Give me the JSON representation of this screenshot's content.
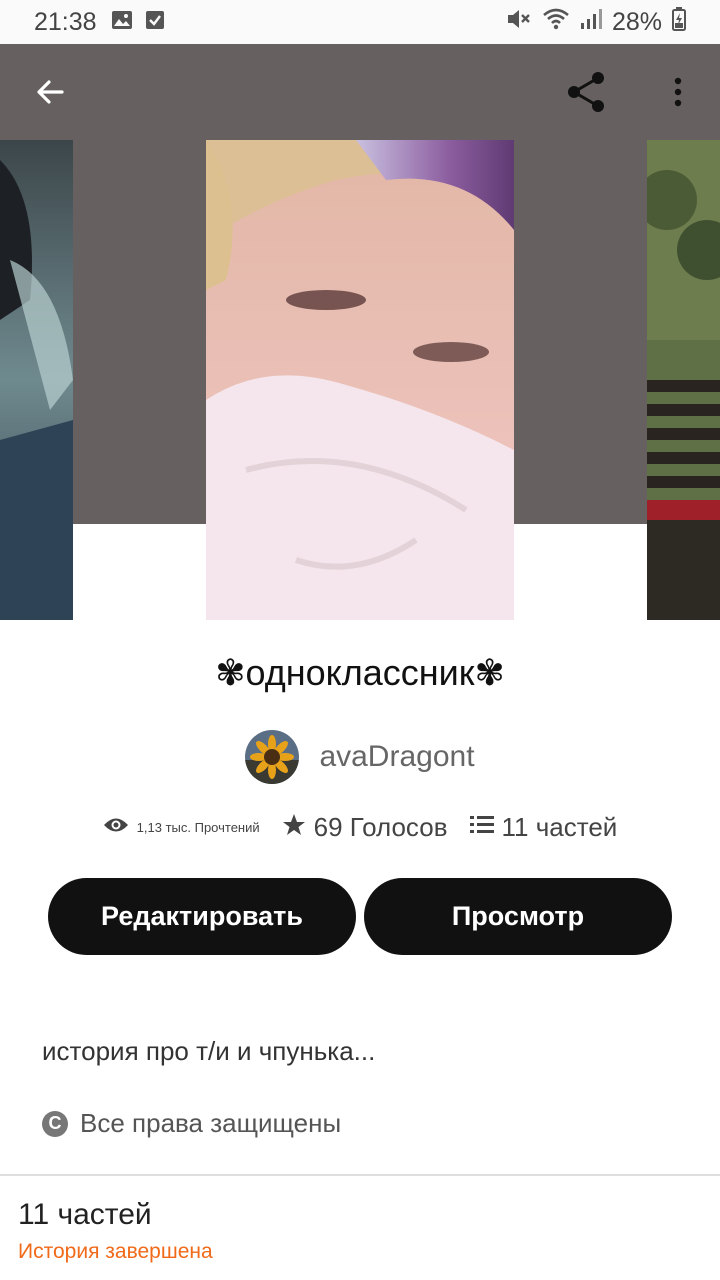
{
  "status_bar": {
    "time": "21:38",
    "battery": "28%",
    "icons": [
      "image-icon",
      "checkbox-icon",
      "mute-icon",
      "wifi-icon",
      "signal-icon",
      "battery-icon"
    ]
  },
  "toolbar": {
    "icons": [
      "back-arrow-icon",
      "share-icon",
      "more-vert-icon"
    ]
  },
  "story": {
    "title": "✾одноклассник✾",
    "author": "avaDragont",
    "reads": "1,13 тыс. Прочтений",
    "votes": "69 Голосов",
    "parts": "11 частей",
    "description": "история про т/и и чпунька...",
    "rights": "Все права защищены"
  },
  "buttons": {
    "edit": "Редактировать",
    "view": "Просмотр"
  },
  "footer": {
    "parts_count": "11 частей",
    "status": "История завершена"
  },
  "colors": {
    "hero_bg": "#676060",
    "button_bg": "#111111",
    "accent_orange": "#f06a19"
  }
}
